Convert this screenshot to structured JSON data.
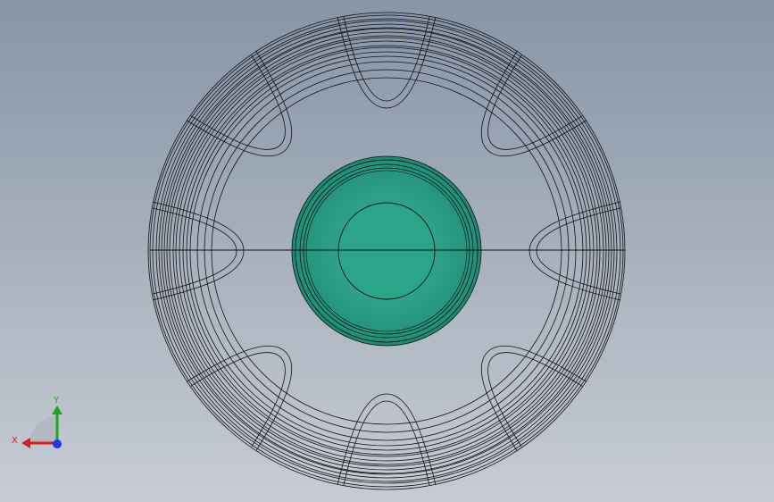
{
  "viewport": {
    "background_top": "#8795a8",
    "background_bottom": "#c7ccd4"
  },
  "model": {
    "wire_color": "#111111",
    "hub_fill": "#2e9f87",
    "hub_dark": "#1d7c69",
    "spoke_count": 8
  },
  "triad": {
    "x_label": "X",
    "y_label": "Y",
    "x_color": "#d81e1e",
    "y_color": "#1ea81e",
    "z_color": "#1e3ad8"
  }
}
